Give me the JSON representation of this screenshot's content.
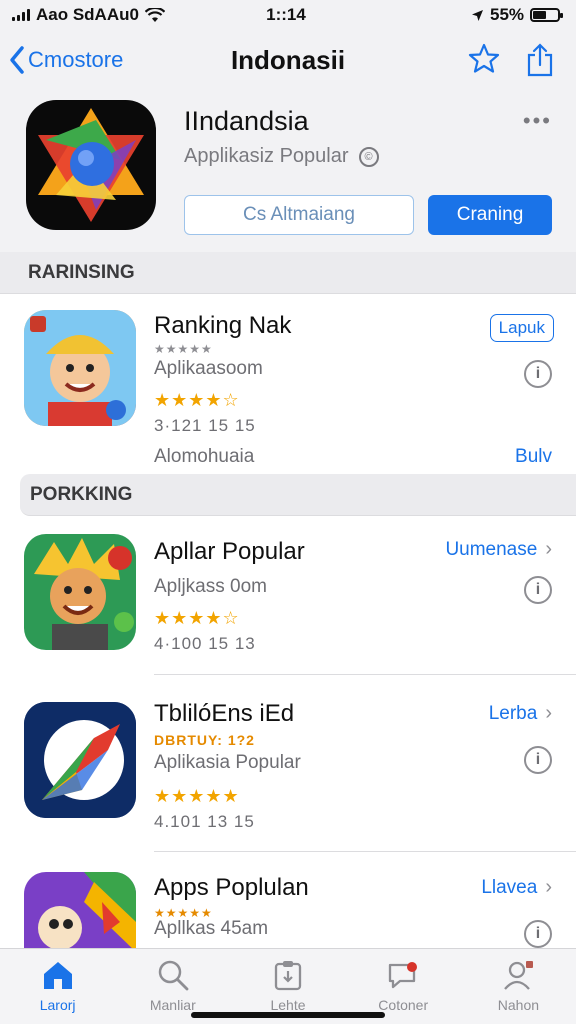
{
  "status": {
    "carrier": "Aao SdAAu0",
    "time": "1::14",
    "battery": "55%",
    "battery_level": 0.55
  },
  "nav": {
    "back_label": "Cmostore",
    "title": "Indonasii"
  },
  "app": {
    "name": "IIndandsia",
    "subtitle": "Applikasiz Popular",
    "more": "•••",
    "secondary_button": "Cs Altmaiang",
    "primary_button": "Craning"
  },
  "sections": {
    "first": "RARINSING",
    "second": "PORKKING"
  },
  "list_top": {
    "title": "Ranking Nak",
    "tiny": "★★★★★",
    "subtitle": "Aplikaasoom",
    "stars": "★★★★☆",
    "meta": "3·121 15 15",
    "action": "Lapuk",
    "footer_left": "Alomohuaia",
    "footer_right": "Bulv"
  },
  "list_bottom": [
    {
      "title": "Apllar Popular",
      "subtitle": "Apljkass 0om",
      "stars": "★★★★☆",
      "meta": "4·100 15 13",
      "action": "Uumenase"
    },
    {
      "title": "TblilóEns iEd",
      "tiny": "DBRTUY: 1?2",
      "subtitle": "Aplikasia Popular",
      "stars": "★★★★★",
      "meta": "4.101 13 15",
      "action": "Lerba"
    },
    {
      "title": "Apps Poplulan",
      "tiny": "★★★★★",
      "subtitle": "Apllkas 45am",
      "action": "Llavea"
    }
  ],
  "tabs": [
    {
      "label": "Larorj",
      "icon": "house-icon",
      "active": true
    },
    {
      "label": "Manliar",
      "icon": "search-icon",
      "active": false
    },
    {
      "label": "Lehte",
      "icon": "clipboard-icon",
      "active": false
    },
    {
      "label": "Cotoner",
      "icon": "chat-bubble-icon",
      "active": false
    },
    {
      "label": "Nahon",
      "icon": "person-icon",
      "active": false
    }
  ],
  "colors": {
    "accent": "#1a73e8",
    "star": "#f2a400",
    "header_bg": "#f2f2f4"
  }
}
